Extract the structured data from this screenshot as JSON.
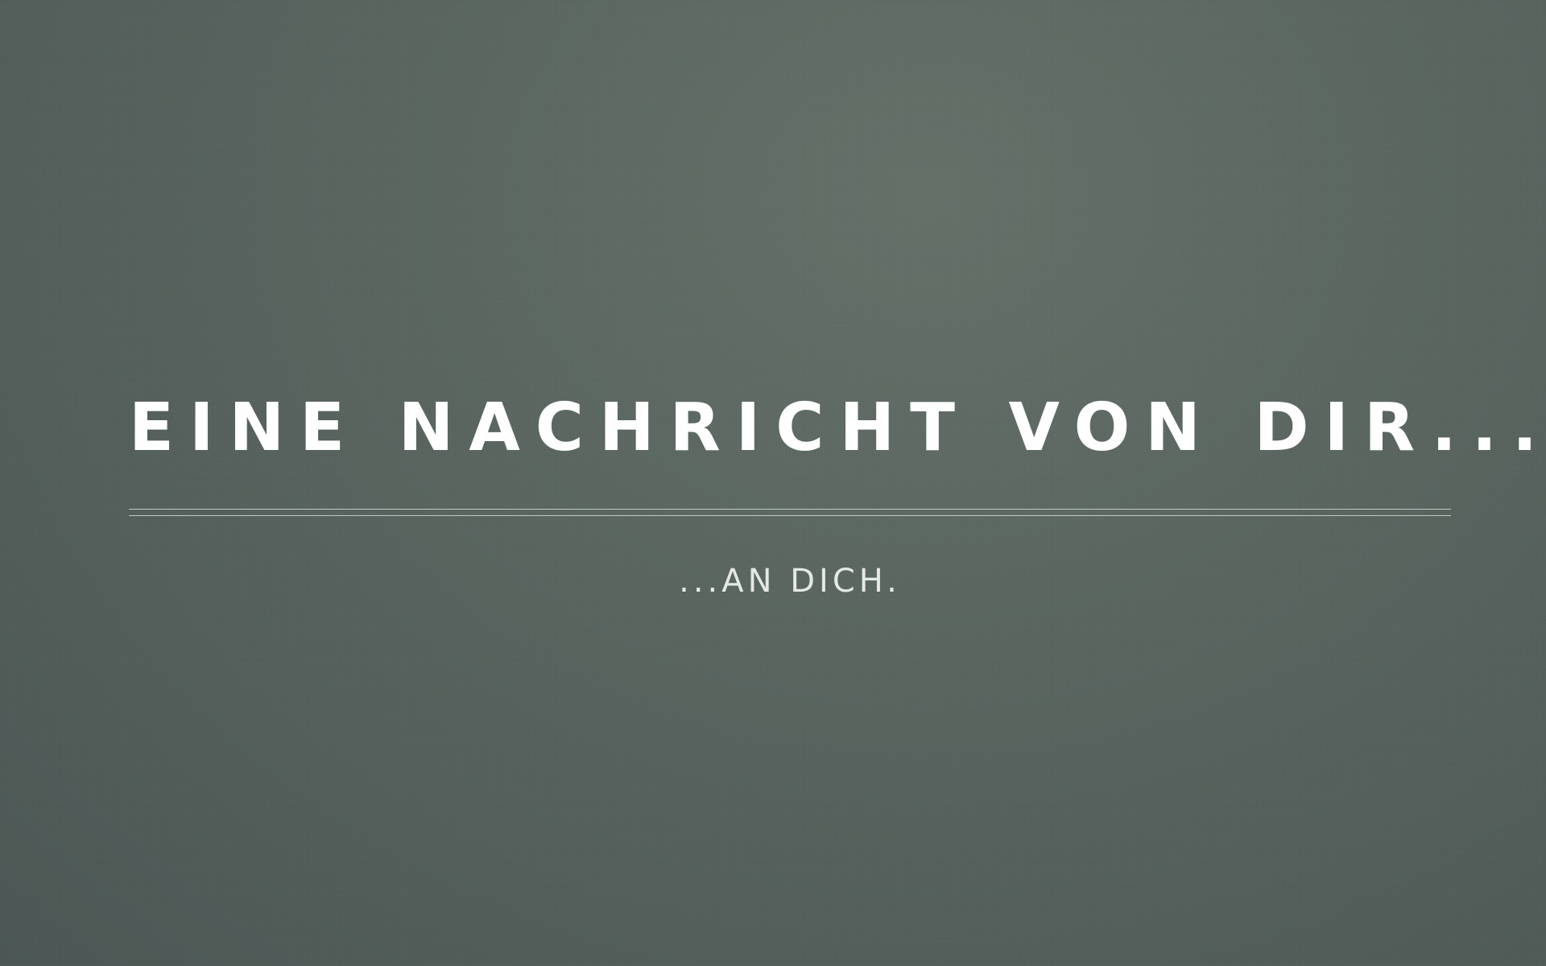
{
  "hero": {
    "headline": "EINE NACHRICHT VON DIR...",
    "subline": "...AN DICH."
  },
  "colors": {
    "background": "#59645f",
    "headline": "#ffffff",
    "subline": "#e4e9e6",
    "divider": "#e6ece8"
  }
}
